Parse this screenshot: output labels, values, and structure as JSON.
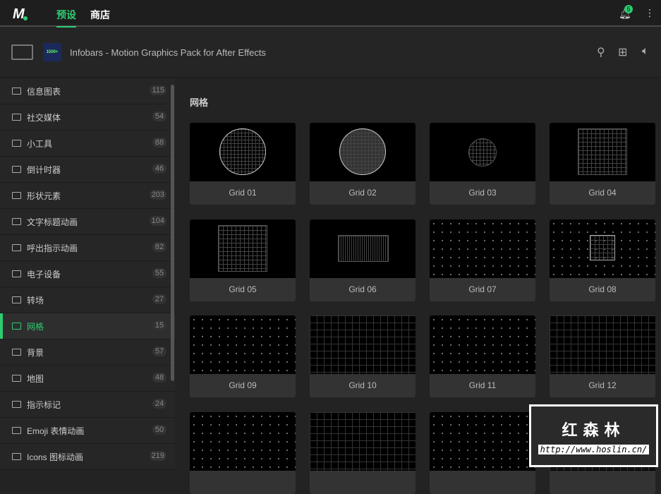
{
  "topbar": {
    "tabs": [
      "预设",
      "商店"
    ],
    "notification_count": "5"
  },
  "header": {
    "pack_thumb": "1500+",
    "title": "Infobars - Motion Graphics Pack for After Effects"
  },
  "sidebar": {
    "items": [
      {
        "label": "信息图表",
        "count": "115"
      },
      {
        "label": "社交媒体",
        "count": "54"
      },
      {
        "label": "小工具",
        "count": "88"
      },
      {
        "label": "倒计时器",
        "count": "46"
      },
      {
        "label": "形状元素",
        "count": "203"
      },
      {
        "label": "文字标题动画",
        "count": "104"
      },
      {
        "label": "呼出指示动画",
        "count": "82"
      },
      {
        "label": "电子设备",
        "count": "55"
      },
      {
        "label": "转场",
        "count": "27"
      },
      {
        "label": "网格",
        "count": "15"
      },
      {
        "label": "背景",
        "count": "57"
      },
      {
        "label": "地图",
        "count": "48"
      },
      {
        "label": "指示标记",
        "count": "24"
      },
      {
        "label": "Emoji 表情动画",
        "count": "50"
      },
      {
        "label": "Icons 图标动画",
        "count": "219"
      }
    ],
    "selected": 9
  },
  "main": {
    "section_title": "网格",
    "items": [
      "Grid 01",
      "Grid 02",
      "Grid 03",
      "Grid 04",
      "Grid 05",
      "Grid 06",
      "Grid 07",
      "Grid 08",
      "Grid 09",
      "Grid 10",
      "Grid 11",
      "Grid 12",
      "",
      "",
      "",
      ""
    ]
  },
  "watermark": {
    "name": "红森林",
    "url": "http://www.hoslin.cn/"
  },
  "colors": {
    "accent": "#2ecc71"
  }
}
